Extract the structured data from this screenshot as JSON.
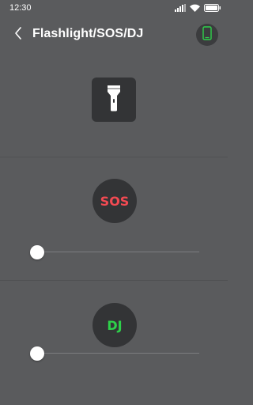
{
  "status_bar": {
    "time": "12:30",
    "icons": [
      "signal-icon",
      "wifi-icon",
      "battery-icon"
    ]
  },
  "app_bar": {
    "back_icon": "back-chevron-icon",
    "title": "Flashlight/SOS/DJ",
    "screen_icon": "phone-screen-icon"
  },
  "flashlight": {
    "icon": "flashlight-icon"
  },
  "sos": {
    "label": "SOS",
    "color": "#f24a52",
    "speed_fraction": 0.0
  },
  "dj": {
    "label": "DJ",
    "color": "#2ed14a",
    "speed_fraction": 0.0
  },
  "colors": {
    "background": "#5a5b5d",
    "button": "#333436",
    "screen_icon_green": "#2ed14a"
  }
}
